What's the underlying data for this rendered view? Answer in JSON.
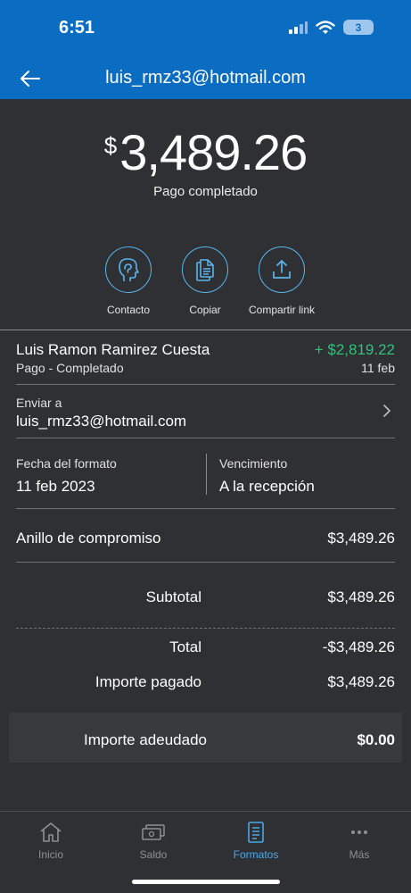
{
  "status_bar": {
    "time": "6:51",
    "battery": "3"
  },
  "header": {
    "title": "luis_rmz33@hotmail.com",
    "back_icon": "arrow-left-icon"
  },
  "payment": {
    "currency_symbol": "$",
    "amount": "3,489.26",
    "status": "Pago completado"
  },
  "actions": [
    {
      "label": "Contacto",
      "icon": "contact-icon"
    },
    {
      "label": "Copiar",
      "icon": "copy-icon"
    },
    {
      "label": "Compartir link",
      "icon": "share-icon"
    }
  ],
  "transaction": {
    "name": "Luis Ramon Ramirez  Cuesta",
    "amount": "+ $2,819.22",
    "subtitle": "Pago - Completado",
    "date": "11 feb"
  },
  "send_to": {
    "label": "Enviar a",
    "value": "luis_rmz33@hotmail.com"
  },
  "invoice_date": {
    "label": "Fecha del formato",
    "value": "11 feb 2023"
  },
  "due": {
    "label": "Vencimiento",
    "value": "A la recepción"
  },
  "line_item": {
    "name": "Anillo de compromiso",
    "price": "$3,489.26"
  },
  "summary": {
    "subtotal_label": "Subtotal",
    "subtotal_value": "$3,489.26",
    "total_label": "Total",
    "total_value": "-$3,489.26",
    "paid_label": "Importe pagado",
    "paid_value": "$3,489.26",
    "owed_label": "Importe adeudado",
    "owed_value": "$0.00"
  },
  "tabs": [
    {
      "label": "Inicio",
      "icon": "home-icon",
      "active": false
    },
    {
      "label": "Saldo",
      "icon": "wallet-icon",
      "active": false
    },
    {
      "label": "Formatos",
      "icon": "invoice-icon",
      "active": true
    },
    {
      "label": "Más",
      "icon": "more-icon",
      "active": false
    }
  ],
  "colors": {
    "header": "#0b6dc2",
    "accent": "#4aa8ea",
    "credit": "#2fc27a",
    "background": "#2f3033"
  }
}
